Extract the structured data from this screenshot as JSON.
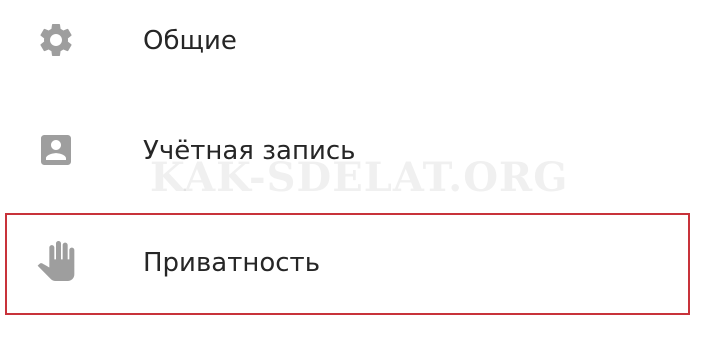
{
  "settings_menu": {
    "items": [
      {
        "label": "Общие",
        "icon": "gear-icon"
      },
      {
        "label": "Учётная запись",
        "icon": "account-box-icon"
      },
      {
        "label": "Приватность",
        "icon": "hand-icon"
      }
    ]
  },
  "watermark": "KAK-SDELAT.ORG",
  "colors": {
    "icon": "#9e9e9e",
    "text": "#262626",
    "highlight_border": "#c8323a",
    "background": "#ffffff"
  }
}
